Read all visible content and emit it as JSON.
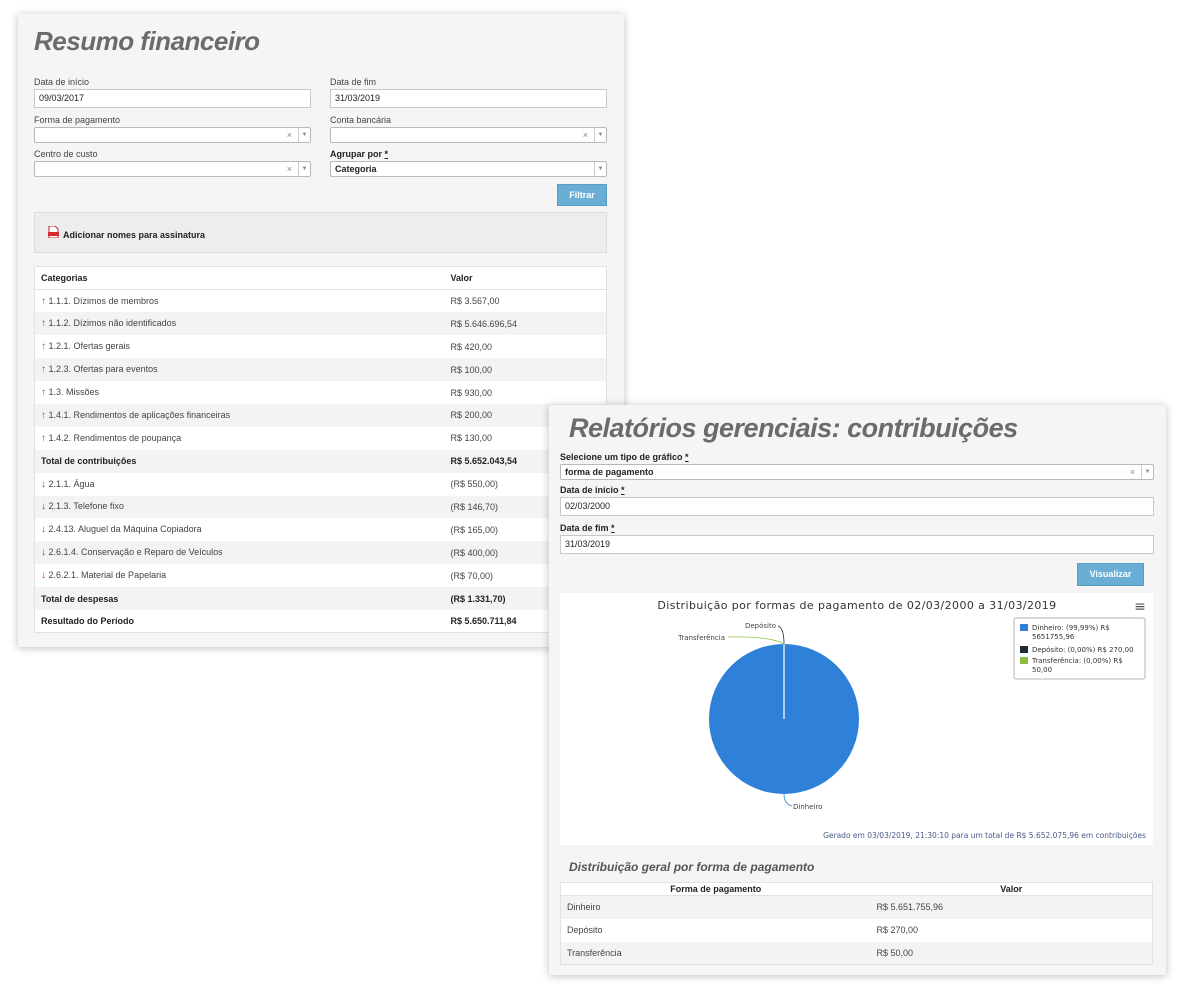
{
  "financial_summary": {
    "title": "Resumo financeiro",
    "start_date_label": "Data de início",
    "start_date_value": "09/03/2017",
    "end_date_label": "Data de fim",
    "end_date_value": "31/03/2019",
    "payment_method_label": "Forma de pagamento",
    "bank_account_label": "Conta bancária",
    "cost_center_label": "Centro de custo",
    "group_by_label": "Agrupar por",
    "required_mark": "*",
    "group_by_value": "Categoria",
    "clear_glyph": "×",
    "arrow_glyph": "▼",
    "filter_button": "Filtrar",
    "signature_link": "Adicionar nomes para assinatura",
    "table": {
      "headers": [
        "Categorias",
        "Valor"
      ],
      "rows": [
        {
          "type": "income",
          "label": "1.1.1. Dízimos de membros",
          "value": "R$ 3.567,00"
        },
        {
          "type": "income",
          "label": "1.1.2. Dízimos não identificados",
          "value": "R$ 5.646.696,54"
        },
        {
          "type": "income",
          "label": "1.2.1. Ofertas gerais",
          "value": "R$ 420,00"
        },
        {
          "type": "income",
          "label": "1.2.3. Ofertas para eventos",
          "value": "R$ 100,00"
        },
        {
          "type": "income",
          "label": "1.3. Missões",
          "value": "R$ 930,00"
        },
        {
          "type": "income",
          "label": "1.4.1. Rendimentos de aplicações financeiras",
          "value": "R$ 200,00"
        },
        {
          "type": "income",
          "label": "1.4.2. Rendimentos de poupança",
          "value": "R$ 130,00"
        },
        {
          "type": "total",
          "label": "Total de contribuições",
          "value": "R$ 5.652.043,54"
        },
        {
          "type": "expense",
          "label": "2.1.1. Água",
          "value": "(R$ 550,00)"
        },
        {
          "type": "expense",
          "label": "2.1.3. Telefone fixo",
          "value": "(R$ 146,70)"
        },
        {
          "type": "expense",
          "label": "2.4.13. Aluguel da Máquina Copiadora",
          "value": "(R$ 165,00)"
        },
        {
          "type": "expense",
          "label": "2.6.1.4. Conservação e Reparo de Veículos",
          "value": "(R$ 400,00)"
        },
        {
          "type": "expense",
          "label": "2.6.2.1. Material de Papelaria",
          "value": "(R$ 70,00)"
        },
        {
          "type": "total",
          "label": "Total de despesas",
          "value": "(R$ 1.331,70)"
        },
        {
          "type": "total",
          "label": "Resultado do Período",
          "value": "R$ 5.650.711,84"
        }
      ]
    }
  },
  "management_reports": {
    "title": "Relatórios gerenciais: contribuições",
    "chart_type_label": "Selecione um tipo de gráfico",
    "chart_type_value": "forma de pagamento",
    "start_date_label": "Data de início",
    "start_date_value": "02/03/2000",
    "end_date_label": "Data de fim",
    "end_date_value": "31/03/2019",
    "required_mark": "*",
    "clear_glyph": "×",
    "arrow_glyph": "▼",
    "view_button": "Visualizar",
    "menu_glyph": "≡",
    "chart_caption": "Gerado em 03/03/2019, 21:30:10 para um total de R$ 5.652.075,96 em contribuições",
    "table_title": "Distribuição geral por forma de pagamento",
    "table": {
      "headers": [
        "Forma de pagamento",
        "Valor"
      ],
      "rows": [
        {
          "method": "Dinheiro",
          "value": "R$ 5.651.755,96"
        },
        {
          "method": "Depósito",
          "value": "R$ 270,00"
        },
        {
          "method": "Transferência",
          "value": "R$ 50,00"
        }
      ]
    }
  },
  "chart_data": {
    "type": "pie",
    "title": "Distribuição por formas de pagamento de 02/03/2000 a 31/03/2019",
    "categories": [
      "Dinheiro",
      "Depósito",
      "Transferência"
    ],
    "values": [
      5651755.96,
      270.0,
      50.0
    ],
    "colors": [
      "#2f80d9",
      "#1c2a3a",
      "#8cbf3f"
    ],
    "legend": [
      {
        "line1": "Dinheiro: (99,99%) R$",
        "line2": "5651755,96"
      },
      {
        "line1": "Depósito: (0,00%) R$ 270,00",
        "line2": ""
      },
      {
        "line1": "Transferência: (0,00%) R$",
        "line2": "50,00"
      }
    ],
    "legend_position": "top-right"
  }
}
